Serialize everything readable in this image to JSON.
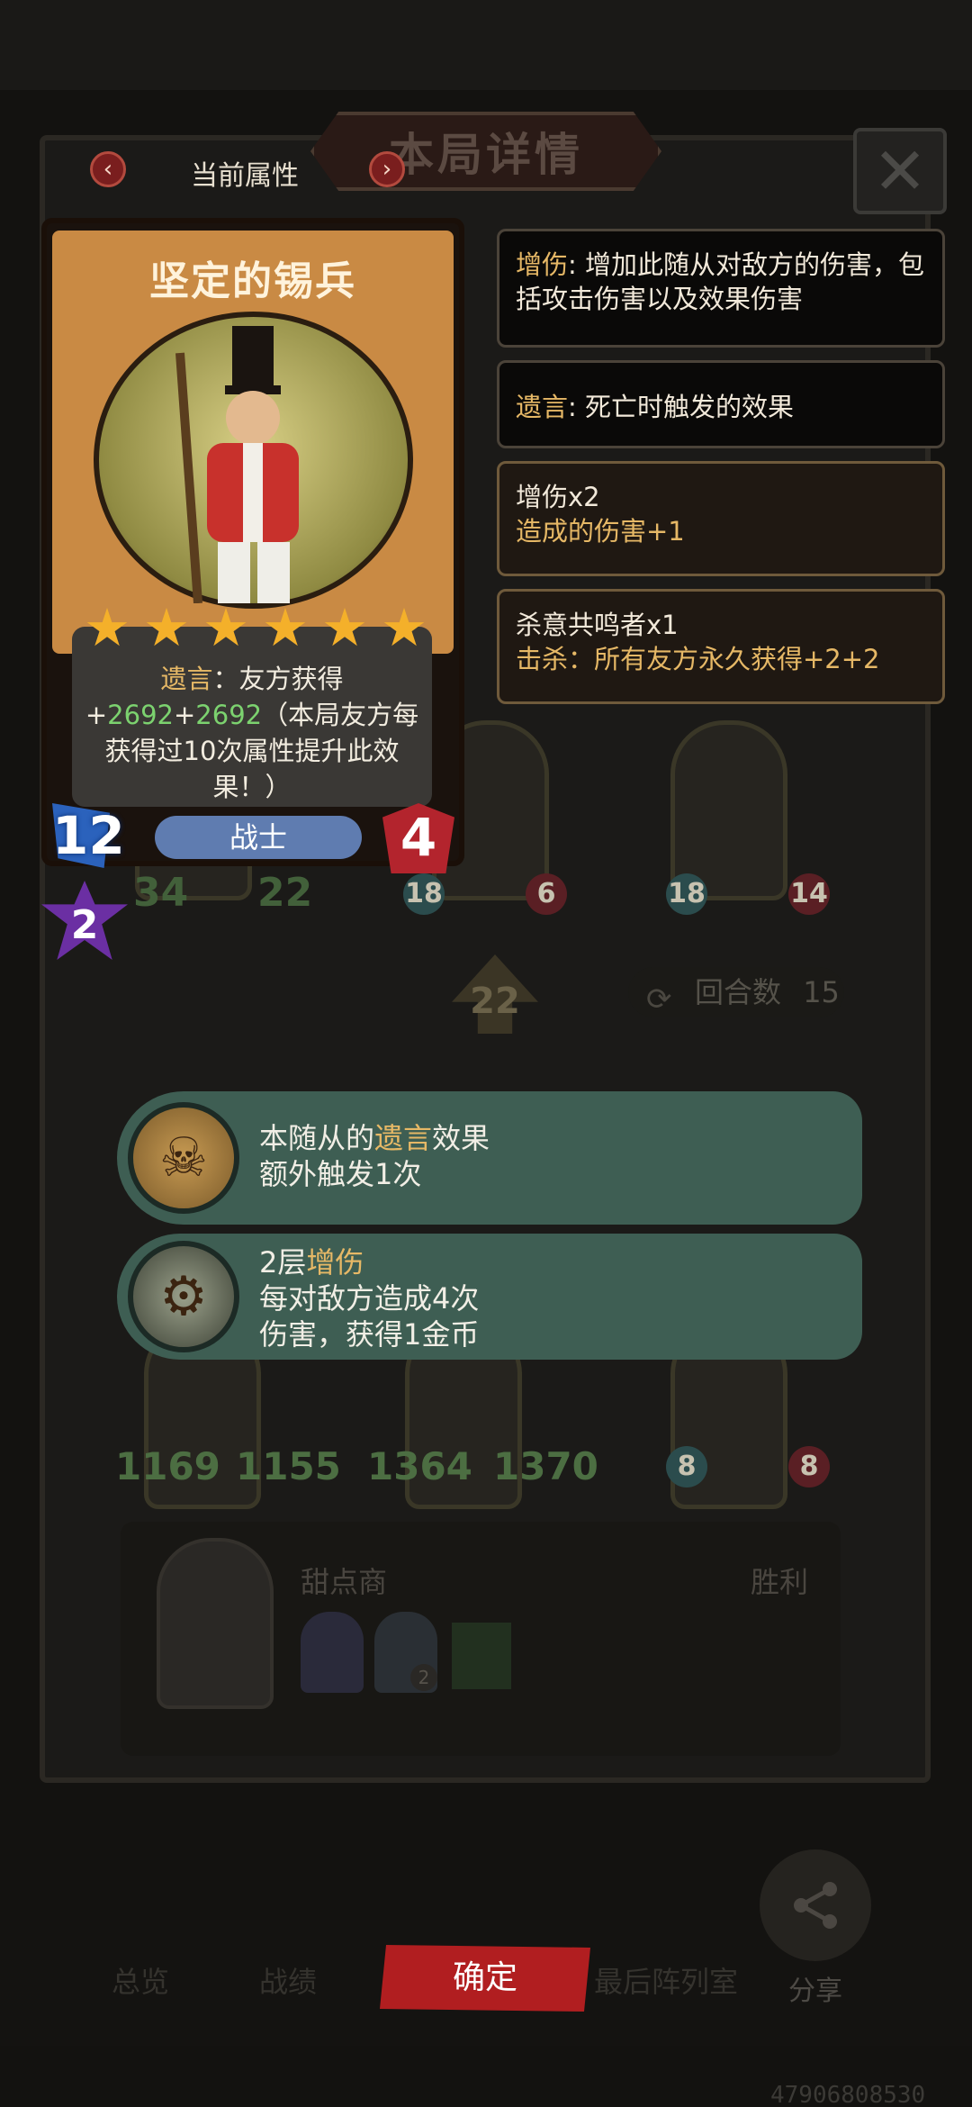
{
  "header": {
    "title": "本局详情",
    "attr_label": "当前属性",
    "prev_arrow": "‹",
    "next_arrow": "›",
    "close_glyph": "✕"
  },
  "card": {
    "name": "坚定的锡兵",
    "stars": [
      "★",
      "★",
      "★",
      "★",
      "★",
      "★"
    ],
    "desc_kw": "遗言",
    "desc_part1": "：友方获得",
    "desc_plus1": "+",
    "desc_val1": "2692",
    "desc_plus2": "+",
    "desc_val2": "2692",
    "desc_part2": "（本局友方每获得过10次属性提升此效果！）",
    "attack": "12",
    "health": "4",
    "class": "战士",
    "tier": "2"
  },
  "tips": [
    {
      "kw": "增伤",
      "text": ": 增加此随从对敌方的伤害，包括攻击伤害以及效果伤害"
    },
    {
      "kw": "遗言",
      "text": ": 死亡时触发的效果"
    },
    {
      "title": "增伤x2",
      "line": "造成的伤害+1"
    },
    {
      "title": "杀意共鸣者x1",
      "line": "击杀：所有友方永久获得+2+2"
    }
  ],
  "board": {
    "row1": [
      {
        "atk": "34",
        "hp": "22"
      },
      {
        "atk": "18",
        "hp": "6"
      },
      {
        "atk": "18",
        "hp": "14"
      }
    ],
    "center_level": "22",
    "rounds_label": "回合数",
    "rounds_value": "15",
    "row3": [
      {
        "atk": "1169",
        "hp": "1155"
      },
      {
        "atk": "1364",
        "hp": "1370"
      },
      {
        "atk": "8",
        "hp": "8"
      }
    ],
    "side_value": "2"
  },
  "popups": [
    {
      "pre": "本随从的",
      "kw": "遗言",
      "post": "效果",
      "line2": "额外触发1次"
    },
    {
      "pre": "2层",
      "kw": "增伤",
      "line2": "每对敌方造成4次",
      "line3": "伤害，获得1金币"
    }
  ],
  "player": {
    "name": "甜点商",
    "result": "胜利",
    "badge": "2"
  },
  "nav": {
    "overview": "总览",
    "record": "战绩",
    "confirm": "确定",
    "lineup": "最后阵列室",
    "share": "分享"
  },
  "footer_id": "47906808530",
  "icons": {
    "share": "share-icon",
    "close": "close-icon",
    "star": "star-icon",
    "rounds": "refresh-icon"
  },
  "colors": {
    "keyword": "#e6b866",
    "buff": "#7cd26f",
    "confirm": "#b11e20",
    "popup": "#3e5e53"
  }
}
